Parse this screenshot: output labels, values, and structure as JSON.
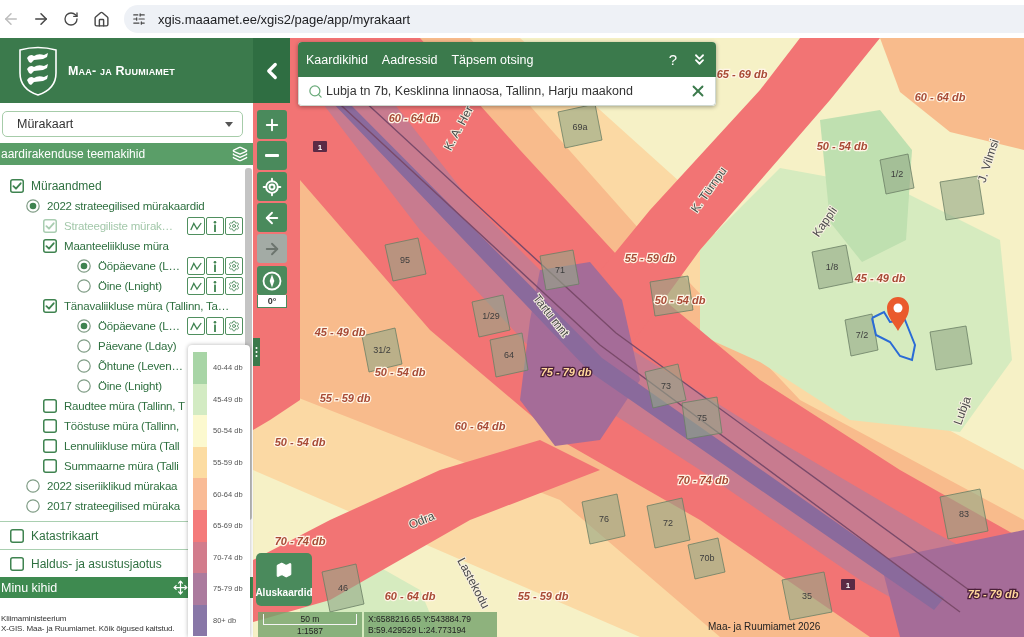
{
  "browser": {
    "back": {
      "disabled": true
    },
    "forward": {
      "disabled": false
    },
    "url": "xgis.maaamet.ee/xgis2/page/app/myrakaart"
  },
  "sidebar": {
    "brand": "Maa- ja Ruumiamet",
    "map_select": {
      "value": "Mürakaart"
    },
    "section_title": "aardirakenduse teemakihid",
    "layers": [
      {
        "kind": "checkbox",
        "label": "Müraandmed",
        "checked": true,
        "disabled": false,
        "tools": false,
        "children": [
          {
            "kind": "radio",
            "label": "2022 strateegilised mürakaardid",
            "selected": true,
            "disabled": false,
            "tools": false,
            "children": [
              {
                "kind": "checkbox",
                "label": "Strateegiliste mürak…",
                "checked": true,
                "disabled": true,
                "tools": true
              },
              {
                "kind": "checkbox",
                "label": "Maanteeliikluse müra",
                "checked": true,
                "disabled": false,
                "tools": false,
                "children": [
                  {
                    "kind": "radio",
                    "label": "Ööpäevane (L…",
                    "selected": true,
                    "disabled": false,
                    "tools": true
                  },
                  {
                    "kind": "radio",
                    "label": "Öine (Lnight)",
                    "selected": false,
                    "disabled": false,
                    "tools": true
                  }
                ]
              },
              {
                "kind": "checkbox",
                "label": "Tänavaliikluse müra (Tallinn, Ta…",
                "checked": true,
                "disabled": false,
                "tools": false,
                "children": [
                  {
                    "kind": "radio",
                    "label": "Ööpäevane (L…",
                    "selected": true,
                    "disabled": false,
                    "tools": true
                  },
                  {
                    "kind": "radio",
                    "label": "Päevane (Lday)",
                    "selected": false,
                    "disabled": false,
                    "tools": false
                  },
                  {
                    "kind": "radio",
                    "label": "Õhtune (Leven…",
                    "selected": false,
                    "disabled": false,
                    "tools": false
                  },
                  {
                    "kind": "radio",
                    "label": "Öine (Lnight)",
                    "selected": false,
                    "disabled": false,
                    "tools": false
                  }
                ]
              },
              {
                "kind": "checkbox",
                "label": "Raudtee müra (Tallinn, T",
                "checked": false,
                "disabled": false,
                "tools": false
              },
              {
                "kind": "checkbox",
                "label": "Tööstuse müra (Tallinn,",
                "checked": false,
                "disabled": false,
                "tools": false
              },
              {
                "kind": "checkbox",
                "label": "Lennuliikluse müra (Tall",
                "checked": false,
                "disabled": false,
                "tools": false
              },
              {
                "kind": "checkbox",
                "label": "Summaarne müra (Talli",
                "checked": false,
                "disabled": false,
                "tools": false
              }
            ]
          },
          {
            "kind": "radio",
            "label": "2022 siseriiklikud mürakaa",
            "selected": false,
            "disabled": false,
            "tools": false
          },
          {
            "kind": "radio",
            "label": "2017 strateegilised müraka",
            "selected": false,
            "disabled": false,
            "tools": false
          }
        ]
      },
      {
        "kind": "checkbox",
        "label": "Katastrikaart",
        "checked": false,
        "disabled": false,
        "tools": false
      },
      {
        "kind": "checkbox",
        "label": "Haldus- ja asustusjaotus",
        "checked": false,
        "disabled": false,
        "tools": false
      }
    ],
    "my_layers_title": "Minu kihid",
    "footer": [
      "Kliimaministeerium",
      "X-GIS. Maa- ja Ruumiamet. Kõik õigused kaitstud."
    ]
  },
  "legend": {
    "items": [
      {
        "label": "40-44 db",
        "color": "#a8d5a6"
      },
      {
        "label": "45-49 db",
        "color": "#d3ebc3"
      },
      {
        "label": "50-54 db",
        "color": "#fcf9cf"
      },
      {
        "label": "55-59 db",
        "color": "#fcdca2"
      },
      {
        "label": "60-64 db",
        "color": "#f9bb96"
      },
      {
        "label": "65-69 db",
        "color": "#f47a7a"
      },
      {
        "label": "70-74 db",
        "color": "#d27c8c"
      },
      {
        "label": "75-79 db",
        "color": "#ab7b9e"
      },
      {
        "label": "80+ db",
        "color": "#8877a7"
      }
    ]
  },
  "map_controls": {
    "buttons": [
      {
        "kind": "plus",
        "disabled": false
      },
      {
        "kind": "minus",
        "disabled": false
      },
      {
        "kind": "locate",
        "disabled": false
      },
      {
        "kind": "back",
        "disabled": false
      },
      {
        "kind": "forward",
        "disabled": true
      }
    ],
    "compass": {
      "reading": "0°"
    }
  },
  "search": {
    "tabs": [
      "Kaardikihid",
      "Aadressid",
      "Täpsem otsing"
    ],
    "help": "?",
    "query": "Lubja tn 7b, Kesklinna linnaosa, Tallinn, Harju maakond"
  },
  "basemaps": {
    "label": "Aluskaardid"
  },
  "scale": {
    "distance": "50 m",
    "ratio": "1:1587"
  },
  "coordinates": [
    "X:6588216.65 Y:543884.79",
    "B:59.429529 L:24.773194"
  ],
  "attribution": "Maa- ja Ruumiamet 2026",
  "map": {
    "zone_labels": [
      "65 - 69 db",
      "60 - 64 db",
      "60 - 64 db",
      "50 - 54 db",
      "55 - 59 db",
      "45 - 49 db",
      "50 - 54 db",
      "45 - 49 db",
      "75 - 79 db",
      "55 - 59 db",
      "50 - 54 db",
      "60 - 64 db",
      "50 - 54 db",
      "70 - 74 db",
      "70 - 74 db",
      "60 - 64 db",
      "55 - 59 db",
      "75 - 79 db"
    ],
    "street_labels": [
      "K. A. Her",
      "K. Türnpu",
      "Kappli",
      "J. Vilmsi",
      "Tartu mnt",
      "Odra",
      "Lastekodu",
      "Lubja"
    ],
    "house_numbers": [
      "69a",
      "95",
      "71",
      "1/29",
      "64",
      "73",
      "31/2",
      "76",
      "72",
      "70b",
      "83",
      "75",
      "7/2",
      "1/8",
      "35",
      "46",
      "1/2"
    ],
    "route_numbers": [
      "1",
      "1"
    ]
  }
}
